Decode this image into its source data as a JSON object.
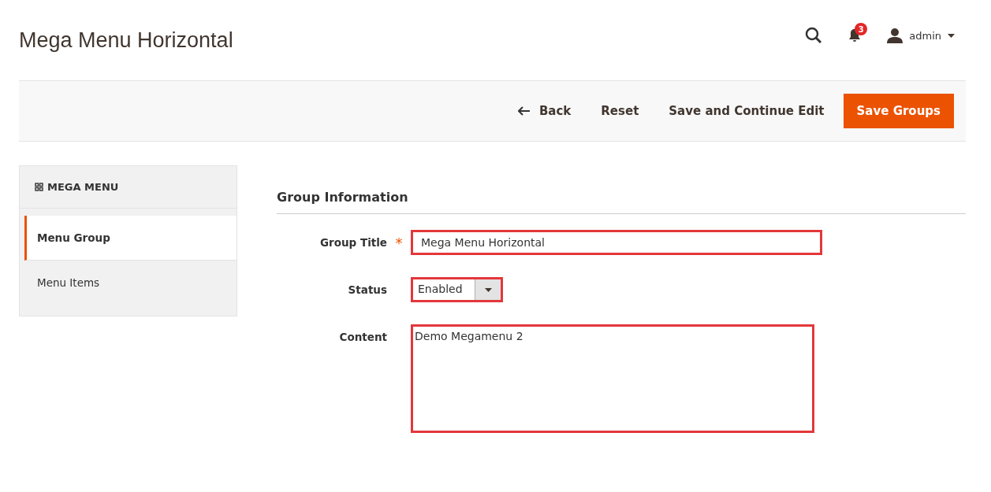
{
  "page_title": "Mega Menu Horizontal",
  "header": {
    "notification_count": "3",
    "user": "admin"
  },
  "actions": [
    {
      "kind": "back",
      "label": "Back"
    },
    {
      "kind": "plain",
      "label": "Reset"
    },
    {
      "kind": "plain",
      "label": "Save and Continue Edit"
    },
    {
      "kind": "primary",
      "label": "Save Groups"
    }
  ],
  "sidebar": {
    "title": "MEGA MENU",
    "items": [
      {
        "label": "Menu Group",
        "selected": true
      },
      {
        "label": "Menu Items",
        "selected": false
      }
    ]
  },
  "section_title": "Group Information",
  "fields": [
    {
      "kind": "text",
      "label": "Group Title",
      "required_mark": "*",
      "value": "Mega Menu Horizontal"
    },
    {
      "kind": "select",
      "label": "Status",
      "value": "Enabled"
    },
    {
      "kind": "textarea",
      "label": "Content",
      "value": "Demo Megamenu 2"
    }
  ]
}
